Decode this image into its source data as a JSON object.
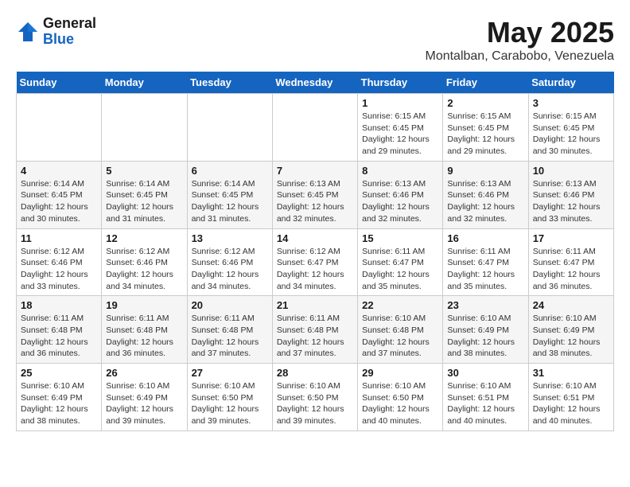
{
  "header": {
    "logo_line1": "General",
    "logo_line2": "Blue",
    "month_title": "May 2025",
    "location": "Montalban, Carabobo, Venezuela"
  },
  "days_of_week": [
    "Sunday",
    "Monday",
    "Tuesday",
    "Wednesday",
    "Thursday",
    "Friday",
    "Saturday"
  ],
  "weeks": [
    [
      {
        "day": "",
        "info": ""
      },
      {
        "day": "",
        "info": ""
      },
      {
        "day": "",
        "info": ""
      },
      {
        "day": "",
        "info": ""
      },
      {
        "day": "1",
        "info": "Sunrise: 6:15 AM\nSunset: 6:45 PM\nDaylight: 12 hours\nand 29 minutes."
      },
      {
        "day": "2",
        "info": "Sunrise: 6:15 AM\nSunset: 6:45 PM\nDaylight: 12 hours\nand 29 minutes."
      },
      {
        "day": "3",
        "info": "Sunrise: 6:15 AM\nSunset: 6:45 PM\nDaylight: 12 hours\nand 30 minutes."
      }
    ],
    [
      {
        "day": "4",
        "info": "Sunrise: 6:14 AM\nSunset: 6:45 PM\nDaylight: 12 hours\nand 30 minutes."
      },
      {
        "day": "5",
        "info": "Sunrise: 6:14 AM\nSunset: 6:45 PM\nDaylight: 12 hours\nand 31 minutes."
      },
      {
        "day": "6",
        "info": "Sunrise: 6:14 AM\nSunset: 6:45 PM\nDaylight: 12 hours\nand 31 minutes."
      },
      {
        "day": "7",
        "info": "Sunrise: 6:13 AM\nSunset: 6:45 PM\nDaylight: 12 hours\nand 32 minutes."
      },
      {
        "day": "8",
        "info": "Sunrise: 6:13 AM\nSunset: 6:46 PM\nDaylight: 12 hours\nand 32 minutes."
      },
      {
        "day": "9",
        "info": "Sunrise: 6:13 AM\nSunset: 6:46 PM\nDaylight: 12 hours\nand 32 minutes."
      },
      {
        "day": "10",
        "info": "Sunrise: 6:13 AM\nSunset: 6:46 PM\nDaylight: 12 hours\nand 33 minutes."
      }
    ],
    [
      {
        "day": "11",
        "info": "Sunrise: 6:12 AM\nSunset: 6:46 PM\nDaylight: 12 hours\nand 33 minutes."
      },
      {
        "day": "12",
        "info": "Sunrise: 6:12 AM\nSunset: 6:46 PM\nDaylight: 12 hours\nand 34 minutes."
      },
      {
        "day": "13",
        "info": "Sunrise: 6:12 AM\nSunset: 6:46 PM\nDaylight: 12 hours\nand 34 minutes."
      },
      {
        "day": "14",
        "info": "Sunrise: 6:12 AM\nSunset: 6:47 PM\nDaylight: 12 hours\nand 34 minutes."
      },
      {
        "day": "15",
        "info": "Sunrise: 6:11 AM\nSunset: 6:47 PM\nDaylight: 12 hours\nand 35 minutes."
      },
      {
        "day": "16",
        "info": "Sunrise: 6:11 AM\nSunset: 6:47 PM\nDaylight: 12 hours\nand 35 minutes."
      },
      {
        "day": "17",
        "info": "Sunrise: 6:11 AM\nSunset: 6:47 PM\nDaylight: 12 hours\nand 36 minutes."
      }
    ],
    [
      {
        "day": "18",
        "info": "Sunrise: 6:11 AM\nSunset: 6:48 PM\nDaylight: 12 hours\nand 36 minutes."
      },
      {
        "day": "19",
        "info": "Sunrise: 6:11 AM\nSunset: 6:48 PM\nDaylight: 12 hours\nand 36 minutes."
      },
      {
        "day": "20",
        "info": "Sunrise: 6:11 AM\nSunset: 6:48 PM\nDaylight: 12 hours\nand 37 minutes."
      },
      {
        "day": "21",
        "info": "Sunrise: 6:11 AM\nSunset: 6:48 PM\nDaylight: 12 hours\nand 37 minutes."
      },
      {
        "day": "22",
        "info": "Sunrise: 6:10 AM\nSunset: 6:48 PM\nDaylight: 12 hours\nand 37 minutes."
      },
      {
        "day": "23",
        "info": "Sunrise: 6:10 AM\nSunset: 6:49 PM\nDaylight: 12 hours\nand 38 minutes."
      },
      {
        "day": "24",
        "info": "Sunrise: 6:10 AM\nSunset: 6:49 PM\nDaylight: 12 hours\nand 38 minutes."
      }
    ],
    [
      {
        "day": "25",
        "info": "Sunrise: 6:10 AM\nSunset: 6:49 PM\nDaylight: 12 hours\nand 38 minutes."
      },
      {
        "day": "26",
        "info": "Sunrise: 6:10 AM\nSunset: 6:49 PM\nDaylight: 12 hours\nand 39 minutes."
      },
      {
        "day": "27",
        "info": "Sunrise: 6:10 AM\nSunset: 6:50 PM\nDaylight: 12 hours\nand 39 minutes."
      },
      {
        "day": "28",
        "info": "Sunrise: 6:10 AM\nSunset: 6:50 PM\nDaylight: 12 hours\nand 39 minutes."
      },
      {
        "day": "29",
        "info": "Sunrise: 6:10 AM\nSunset: 6:50 PM\nDaylight: 12 hours\nand 40 minutes."
      },
      {
        "day": "30",
        "info": "Sunrise: 6:10 AM\nSunset: 6:51 PM\nDaylight: 12 hours\nand 40 minutes."
      },
      {
        "day": "31",
        "info": "Sunrise: 6:10 AM\nSunset: 6:51 PM\nDaylight: 12 hours\nand 40 minutes."
      }
    ]
  ]
}
